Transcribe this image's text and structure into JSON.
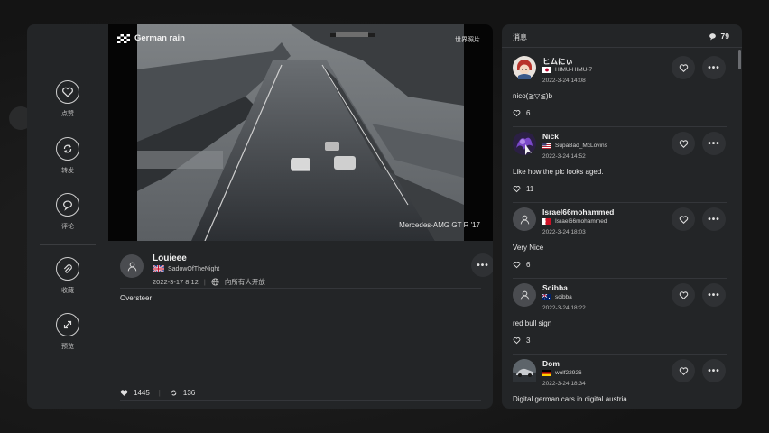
{
  "post": {
    "photo_title": "German rain",
    "photo_tag": "世界照片",
    "car_model": "Mercedes-AMG GT R '17",
    "author_name": "Louieee",
    "author_handle": "SadowOfTheNight",
    "date": "2022-3-17 8:12",
    "visibility": "向所有人开放",
    "caption": "Oversteer",
    "likes": "1445",
    "reposts": "136"
  },
  "actions": [
    {
      "label": "点赞",
      "icon": "heart-icon"
    },
    {
      "label": "转发",
      "icon": "repost-icon"
    },
    {
      "label": "评论",
      "icon": "comment-icon"
    },
    {
      "label": "收藏",
      "icon": "paperclip-icon"
    },
    {
      "label": "预览",
      "icon": "expand-icon"
    }
  ],
  "comments_panel": {
    "title": "消息",
    "count": "79"
  },
  "comments": [
    {
      "name": "ヒムにぃ",
      "handle": "HIMU-HIMU-7",
      "time": "2022-3-24 14:08",
      "text": "nico(≧▽≦)b",
      "likes": "6",
      "flag": "japan",
      "avatar": "anime"
    },
    {
      "name": "Nick",
      "handle": "SupaBad_McLovins",
      "time": "2022-3-24 14:52",
      "text": "Like how the pic looks aged.",
      "likes": "11",
      "flag": "usa",
      "avatar": "purple"
    },
    {
      "name": "Israel66mohammed",
      "handle": "Israel66mohammed",
      "time": "2022-3-24 18:03",
      "text": "Very Nice",
      "likes": "6",
      "flag": "bahrain",
      "avatar": "generic"
    },
    {
      "name": "Scibba",
      "handle": "scibba",
      "time": "2022-3-24 18:22",
      "text": "red bull sign",
      "likes": "3",
      "flag": "australia",
      "avatar": "generic"
    },
    {
      "name": "Dom",
      "handle": "wolf22926",
      "time": "2022-3-24 18:34",
      "text": "Digital german cars in digital austria",
      "likes": "",
      "flag": "germany",
      "avatar": "car"
    }
  ],
  "colors": {
    "background": "#161718",
    "panel": "#232527",
    "button": "#2f3134",
    "text": "#e6e6e6"
  }
}
